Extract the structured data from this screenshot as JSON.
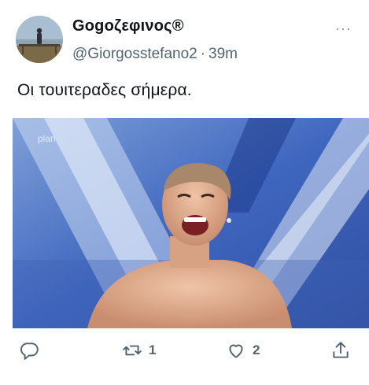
{
  "tweet": {
    "display_name": "Gogoζεφινος®",
    "handle": "@Giorgosstefano2",
    "separator": "·",
    "time": "39m",
    "more": "···",
    "text": "Οι τουιτεραδες σήμερα.",
    "media": {
      "watermark": "plan"
    }
  },
  "actions": {
    "reply": {
      "icon": "reply-icon",
      "count": ""
    },
    "retweet": {
      "icon": "retweet-icon",
      "count": "1"
    },
    "like": {
      "icon": "heart-icon",
      "count": "2"
    },
    "share": {
      "icon": "share-icon",
      "count": ""
    }
  },
  "colors": {
    "text": "#0f1419",
    "secondary": "#536471",
    "media_blue": "#3a63b8"
  }
}
